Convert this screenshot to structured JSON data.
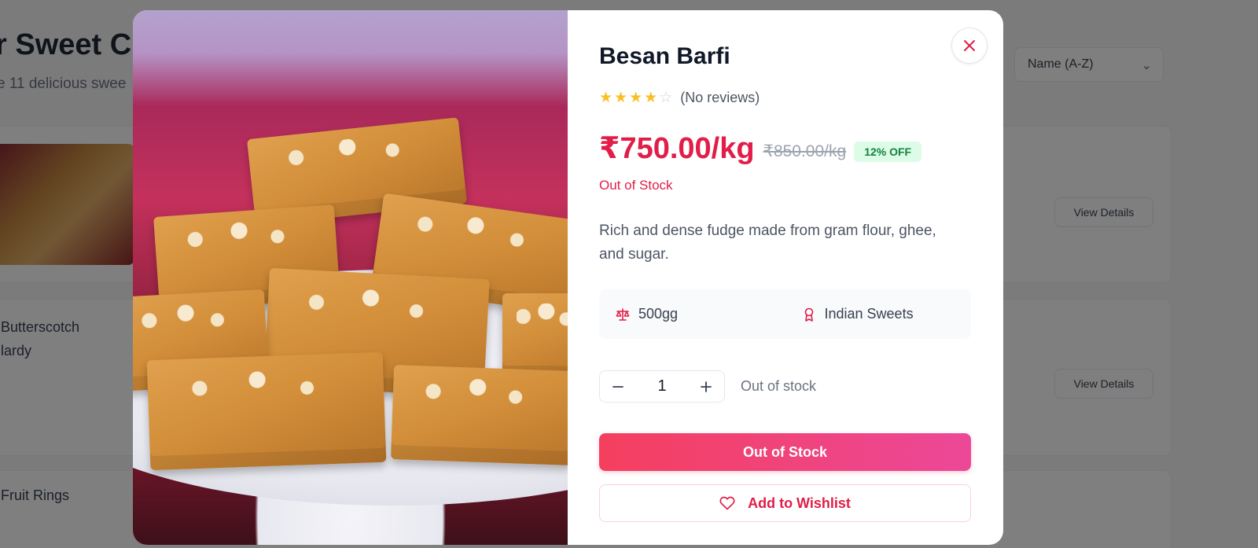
{
  "background": {
    "title": "r Sweet C",
    "subtitle": "e 11 delicious swee",
    "sort_label": "Name (A-Z)",
    "items": [
      {
        "name": "",
        "view_label": "View Details"
      },
      {
        "name": "Butterscotch\nlardy",
        "view_label": "View Details"
      },
      {
        "name": "Fruit Rings",
        "view_label": ""
      }
    ]
  },
  "product": {
    "title": "Besan Barfi",
    "rating": 4,
    "rating_max": 5,
    "reviews_text": "(No reviews)",
    "price": "₹750.00/kg",
    "original_price": "₹850.00/kg",
    "discount_badge": "12% OFF",
    "stock_status": "Out of Stock",
    "description": "Rich and dense fudge made from gram flour, ghee, and sugar.",
    "weight": "500gg",
    "category": "Indian Sweets",
    "quantity": "1",
    "quantity_note": "Out of stock",
    "primary_button": "Out of Stock",
    "wishlist_button": "Add to Wishlist"
  },
  "colors": {
    "accent": "#e11d48",
    "gradient_start": "#f43f5e",
    "gradient_end": "#ec4899",
    "badge_bg": "#dcfce7",
    "badge_text": "#15803d",
    "star": "#fbbf24"
  }
}
